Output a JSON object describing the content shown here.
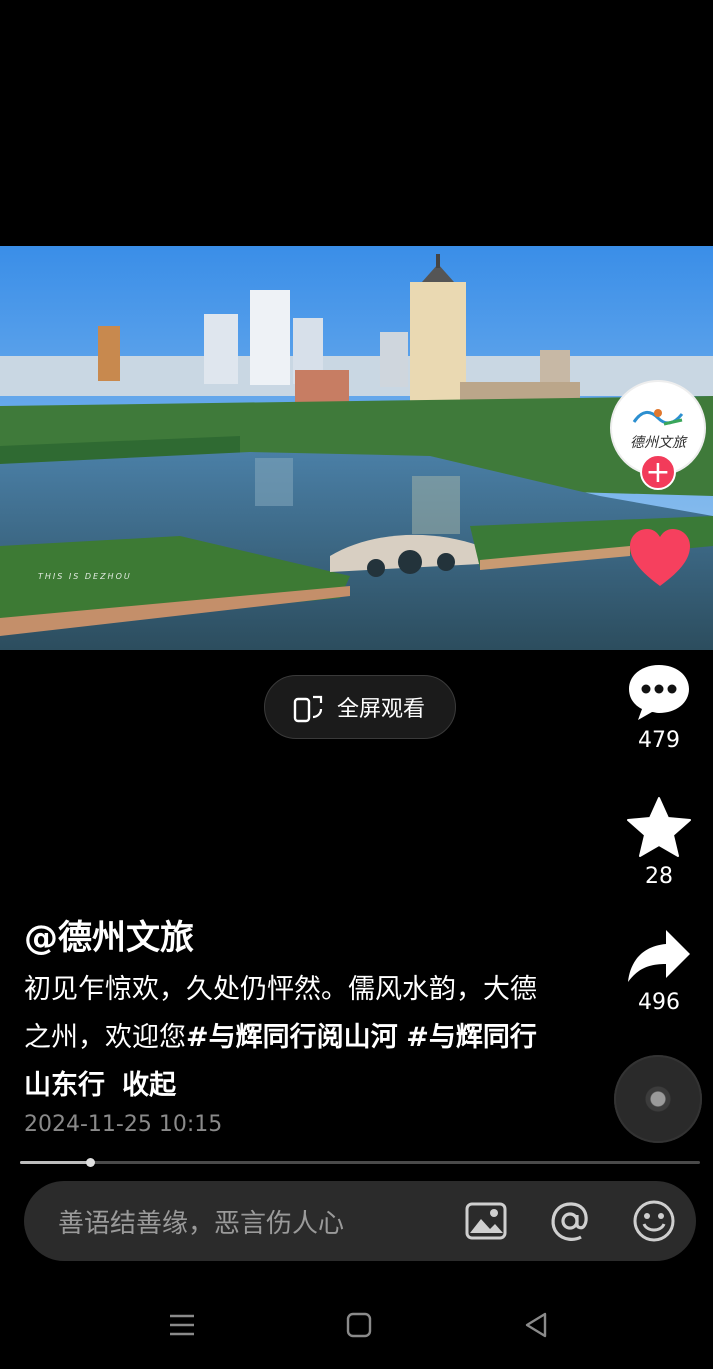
{
  "video": {
    "watermark": "THIS IS DEZHOU"
  },
  "fullscreen": {
    "label": "全屏观看"
  },
  "creator": {
    "logo_text": "德州文旅"
  },
  "actions": {
    "comments": "479",
    "favorites": "28",
    "shares": "496"
  },
  "caption": {
    "author": "@德州文旅",
    "text_plain": "初见乍惊欢，久处仍怦然。儒风水韵，大德之州，欢迎您",
    "tag1": "#与辉同行阅山河",
    "tag2": "#与辉同行山东行",
    "collapse": "收起"
  },
  "timestamp": "2024-11-25 10:15",
  "progress": {
    "fraction": 0.103
  },
  "comment_bar": {
    "placeholder": "善语结善缘，恶言伤人心"
  },
  "colors": {
    "like": "#f6405e",
    "follow": "#f23b5a"
  }
}
